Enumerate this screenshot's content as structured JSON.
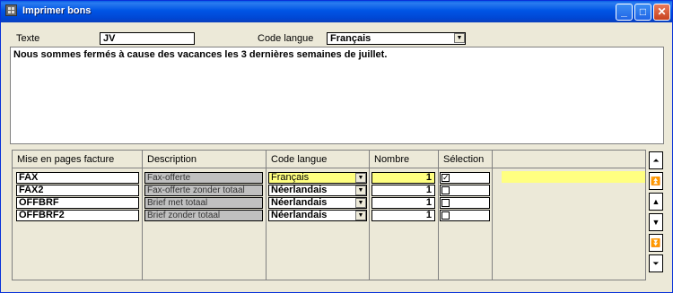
{
  "window": {
    "title": "Imprimer bons"
  },
  "form": {
    "texte_label": "Texte",
    "texte_value": "JV",
    "langue_label": "Code langue",
    "langue_value": "Français",
    "memo": "Nous sommes fermés à cause des vacances les 3 dernières semaines de juillet."
  },
  "grid": {
    "columns": [
      "Mise en pages facture",
      "Description",
      "Code langue",
      "Nombre",
      "Sélection"
    ],
    "rows": [
      {
        "key": "FAX",
        "description": "Fax-offerte",
        "langue": "Français",
        "nombre": "1",
        "selected": true
      },
      {
        "key": "FAX2",
        "description": "Fax-offerte zonder totaal",
        "langue": "Néerlandais",
        "nombre": "1",
        "selected": false
      },
      {
        "key": "OFFBRF",
        "description": "Brief met totaal",
        "langue": "Néerlandais",
        "nombre": "1",
        "selected": false
      },
      {
        "key": "OFFBRF2",
        "description": "Brief zonder totaal",
        "langue": "Néerlandais",
        "nombre": "1",
        "selected": false
      }
    ]
  },
  "colors": {
    "titlebar": "#0055e5",
    "highlight": "#ffff80",
    "desc_bg": "#c0c0c0"
  },
  "icons": [
    "app-grid-icon",
    "minimize-icon",
    "maximize-icon",
    "close-icon",
    "first-record-icon",
    "page-up-icon",
    "previous-icon",
    "next-icon",
    "page-down-icon",
    "last-record-icon",
    "dropdown-arrow-icon",
    "checkbox-icon"
  ]
}
